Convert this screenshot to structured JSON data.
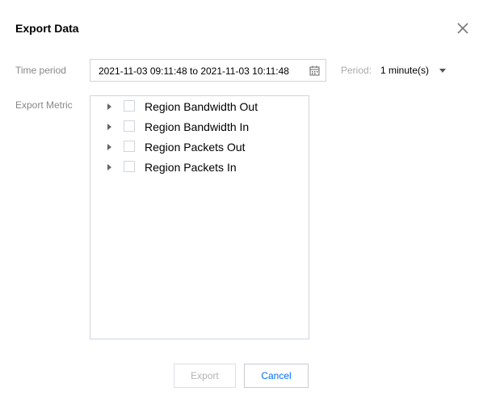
{
  "dialog": {
    "title": "Export Data"
  },
  "time_period": {
    "label": "Time period",
    "value": "2021-11-03 09:11:48 to 2021-11-03 10:11:48"
  },
  "period": {
    "label": "Period:",
    "value": "1 minute(s)"
  },
  "export_metric": {
    "label": "Export Metric",
    "items": [
      {
        "label": "Region Bandwidth Out",
        "checked": false
      },
      {
        "label": "Region Bandwidth In",
        "checked": false
      },
      {
        "label": "Region Packets Out",
        "checked": false
      },
      {
        "label": "Region Packets In",
        "checked": false
      }
    ]
  },
  "buttons": {
    "export_label": "Export",
    "cancel_label": "Cancel"
  },
  "colors": {
    "primary_link": "#006eff",
    "disabled_text": "#b3b3b3",
    "border": "#cfd5de"
  }
}
